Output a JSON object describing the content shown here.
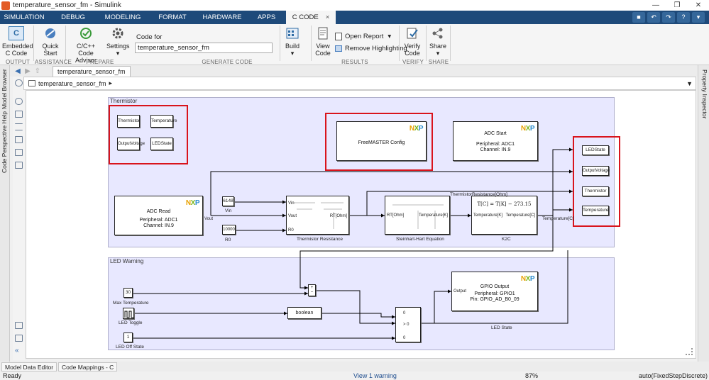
{
  "window": {
    "title": "temperature_sensor_fm - Simulink"
  },
  "tabs": [
    {
      "label": "SIMULATION"
    },
    {
      "label": "DEBUG"
    },
    {
      "label": "MODELING"
    },
    {
      "label": "FORMAT"
    },
    {
      "label": "HARDWARE"
    },
    {
      "label": "APPS"
    },
    {
      "label": "C CODE"
    }
  ],
  "ribbon": {
    "embedded": "Embedded\nC Code",
    "quick_start": "Quick\nStart",
    "advisor": "C/C++ Code\nAdvisor",
    "settings": "Settings",
    "code_for_label": "Code for",
    "code_for_value": "temperature_sensor_fm",
    "build": "Build",
    "view_code": "View\nCode",
    "open_report": "Open Report",
    "remove_highlighting": "Remove Highlighting",
    "verify_code": "Verify\nCode",
    "share": "Share",
    "groups": {
      "output": "OUTPUT",
      "assistance": "ASSISTANCE",
      "prepare": "PREPARE",
      "generate": "GENERATE CODE",
      "results": "RESULTS",
      "verify": "VERIFY",
      "share": "SHARE"
    }
  },
  "browser": {
    "tab_label": "temperature_sensor_fm",
    "path": "temperature_sensor_fm"
  },
  "side_panels": {
    "left": [
      "Model Browser",
      "Code Perspective Help"
    ],
    "right": [
      "Property Inspector"
    ]
  },
  "model": {
    "thermistor_area": "Thermistor",
    "led_area": "LED Warning",
    "freemaster_config": "FreeMASTER Config",
    "adc_start": {
      "title": "ADC Start",
      "peripheral": "Peripheral: ADC1",
      "channel": "Channel: IN.9"
    },
    "adc_read": {
      "title": "ADC Read",
      "peripheral": "Peripheral: ADC1",
      "channel": "Channel: IN.9",
      "port": "Vout"
    },
    "nxp_logo": "NXP",
    "const_vin": {
      "value": "6148",
      "label": "Vin"
    },
    "const_r0": {
      "value": "10000",
      "label": "R0"
    },
    "thermistor_resistance": {
      "label": "Thermistor Resistance",
      "in_vin": "Vin",
      "in_vout": "Vout",
      "in_r0": "R0",
      "out": "RT[Ohm]"
    },
    "steinhart": {
      "label": "Steinhart-Hart Equation",
      "in": "RT[Ohm]",
      "out": "Temperature[K]"
    },
    "k2c": {
      "label": "K2C",
      "in": "Temperature[K]",
      "out": "Temperature[C]",
      "formula": "T[C] = T[K] − 273.15"
    },
    "wire_labels": {
      "thermistor_ohm": "ThermistorResistance[Ohm]",
      "temperature_c": "Temperature[C]",
      "led_state": "LED State"
    },
    "tags": [
      "Thermistor",
      "Temperature",
      "OutputVoltage",
      "LEDState"
    ],
    "goto_tags": [
      "LEDState",
      "OutputVoltage",
      "Thermistor",
      "Temperature"
    ],
    "max_temp": {
      "value": "30",
      "label": "Max Temperature"
    },
    "led_toggle": {
      "label": "LED Toggle"
    },
    "boolean": "boolean",
    "led_off": {
      "value": "1",
      "label": "LED Off State"
    },
    "switch_threshold": "> 0",
    "switch_in_top": "0",
    "switch_in_bottom": "0",
    "sum_plus": "+",
    "sum_minus": "−",
    "gpio": {
      "title": "GPIO Output",
      "peripheral": "Peripheral: GPIO1",
      "pin": "Pin: GPIO_AD_B0_09",
      "port": "Output"
    }
  },
  "bottom_tabs": [
    "Model Data Editor",
    "Code Mappings - C"
  ],
  "status": {
    "left": "Ready",
    "warning": "View 1 warning",
    "zoom": "87%",
    "solver": "auto(FixedStepDiscrete)"
  },
  "colors": {
    "tabbar": "#1e4a7a",
    "area": "#e8e8ff",
    "highlight": "#d9141c"
  }
}
